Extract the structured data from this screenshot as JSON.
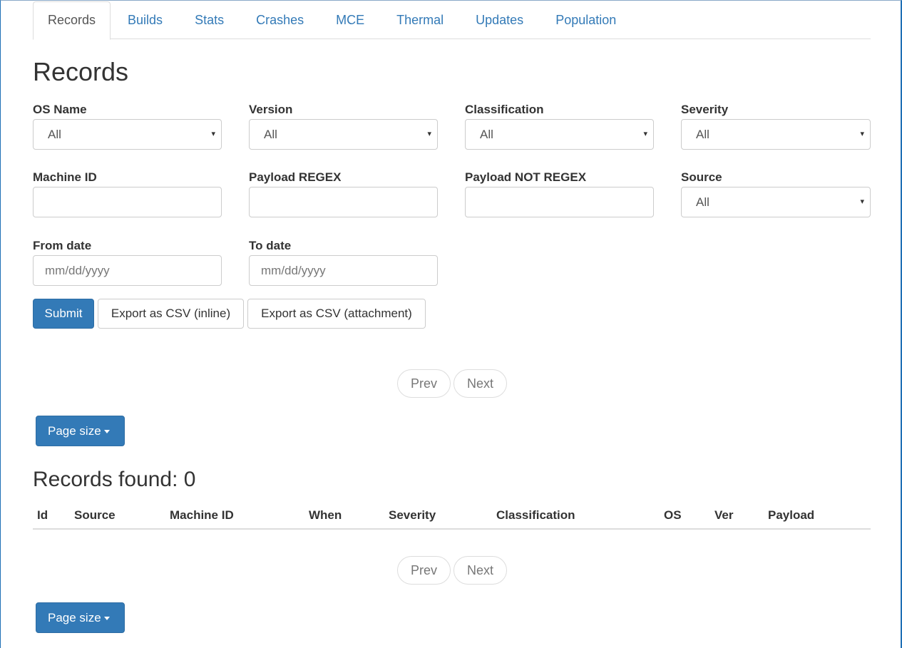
{
  "tabs": [
    "Records",
    "Builds",
    "Stats",
    "Crashes",
    "MCE",
    "Thermal",
    "Updates",
    "Population"
  ],
  "page_title": "Records",
  "filters": {
    "os_name": {
      "label": "OS Name",
      "value": "All"
    },
    "version": {
      "label": "Version",
      "value": "All"
    },
    "classification": {
      "label": "Classification",
      "value": "All"
    },
    "severity": {
      "label": "Severity",
      "value": "All"
    },
    "machine_id": {
      "label": "Machine ID",
      "value": ""
    },
    "payload_regex": {
      "label": "Payload REGEX",
      "value": ""
    },
    "payload_not_regex": {
      "label": "Payload NOT REGEX",
      "value": ""
    },
    "source": {
      "label": "Source",
      "value": "All"
    },
    "from_date": {
      "label": "From date",
      "placeholder": "mm/dd/yyyy"
    },
    "to_date": {
      "label": "To date",
      "placeholder": "mm/dd/yyyy"
    }
  },
  "buttons": {
    "submit": "Submit",
    "export_inline": "Export as CSV (inline)",
    "export_attachment": "Export as CSV (attachment)"
  },
  "pager": {
    "prev": "Prev",
    "next": "Next"
  },
  "page_size_label": "Page size",
  "records_found": "Records found: 0",
  "table_headers": [
    "Id",
    "Source",
    "Machine ID",
    "When",
    "Severity",
    "Classification",
    "OS",
    "Ver",
    "Payload"
  ],
  "colors": {
    "primary": "#337ab7",
    "link": "#337ab7",
    "frame": "#1e6fb5"
  }
}
